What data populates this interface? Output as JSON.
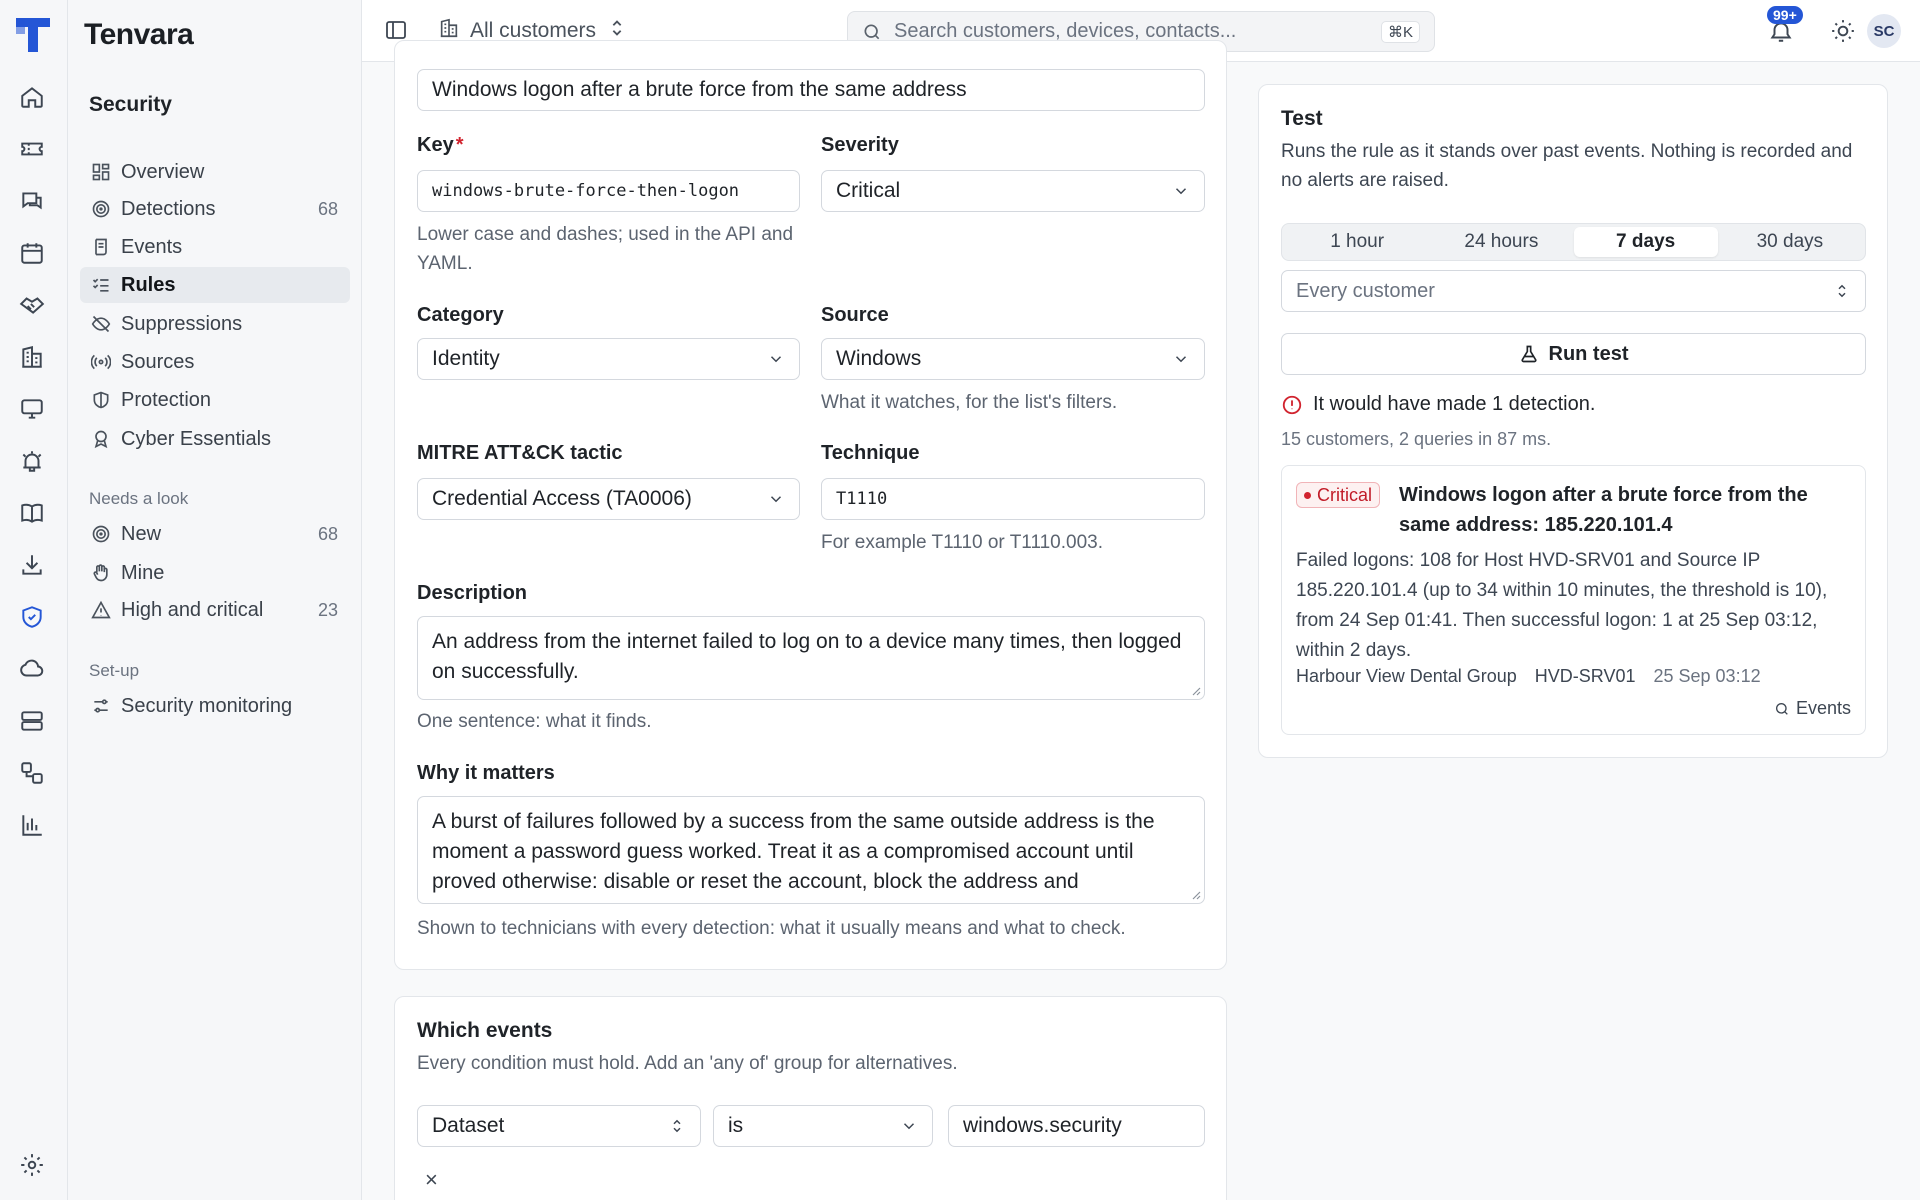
{
  "app": {
    "brand": "Tenvara"
  },
  "rail": {
    "icons": [
      "home-icon",
      "ticket-icon",
      "chat-icon",
      "calendar-icon",
      "handshake-icon",
      "building-icon",
      "monitor-icon",
      "alarm-icon",
      "book-icon",
      "download-icon",
      "shield-icon",
      "cloud-icon",
      "server-icon",
      "workflow-icon",
      "chart-icon",
      "settings-icon"
    ],
    "active": "shield-icon"
  },
  "sidebar": {
    "section_title": "Security",
    "items": [
      {
        "label": "Overview",
        "icon": "dashboard-icon",
        "count": ""
      },
      {
        "label": "Detections",
        "icon": "radar-icon",
        "count": "68"
      },
      {
        "label": "Events",
        "icon": "scroll-icon",
        "count": ""
      },
      {
        "label": "Rules",
        "icon": "list-checks-icon",
        "count": "",
        "active": true
      },
      {
        "label": "Suppressions",
        "icon": "eye-off-icon",
        "count": ""
      },
      {
        "label": "Sources",
        "icon": "broadcast-icon",
        "count": ""
      },
      {
        "label": "Protection",
        "icon": "shield-half-icon",
        "count": ""
      },
      {
        "label": "Cyber Essentials",
        "icon": "award-icon",
        "count": ""
      }
    ],
    "group_look": "Needs a look",
    "look_items": [
      {
        "label": "New",
        "icon": "radar-icon",
        "count": "68"
      },
      {
        "label": "Mine",
        "icon": "hand-icon",
        "count": ""
      },
      {
        "label": "High and critical",
        "icon": "warning-icon",
        "count": "23"
      }
    ],
    "group_setup": "Set-up",
    "setup_items": [
      {
        "label": "Security monitoring",
        "icon": "sliders-icon",
        "count": ""
      }
    ]
  },
  "topbar": {
    "customers_label": "All customers",
    "search_placeholder": "Search customers, devices, contacts...",
    "search_shortcut": "⌘K",
    "notification_badge": "99+",
    "avatar_initials": "SC"
  },
  "form": {
    "name_value": "Windows logon after a brute force from the same address",
    "key_label": "Key",
    "key_required": "*",
    "key_value": "windows-brute-force-then-logon",
    "key_help": "Lower case and dashes; used in the API and YAML.",
    "severity_label": "Severity",
    "severity_value": "Critical",
    "category_label": "Category",
    "category_value": "Identity",
    "source_label": "Source",
    "source_value": "Windows",
    "source_help": "What it watches, for the list's filters.",
    "tactic_label": "MITRE ATT&CK tactic",
    "tactic_value": "Credential Access (TA0006)",
    "technique_label": "Technique",
    "technique_value": "T1110",
    "technique_help": "For example T1110 or T1110.003.",
    "description_label": "Description",
    "description_value": "An address from the internet failed to log on to a device many times, then logged on successfully.",
    "description_help": "One sentence: what it finds.",
    "why_label": "Why it matters",
    "why_value": "A burst of failures followed by a success from the same outside address is the moment a password guess worked. Treat it as a compromised account until proved otherwise: disable or reset the account, block the address and",
    "why_help": "Shown to technicians with every detection: what it usually means and what to check."
  },
  "events": {
    "title": "Which events",
    "subtitle": "Every condition must hold. Add an 'any of' group for alternatives.",
    "field_value": "Dataset",
    "operator_value": "is",
    "match_value": "windows.security",
    "remove_glyph": "×"
  },
  "test": {
    "title": "Test",
    "subtitle": "Runs the rule as it stands over past events. Nothing is recorded and no alerts are raised.",
    "ranges": [
      "1 hour",
      "24 hours",
      "7 days",
      "30 days"
    ],
    "active_range": "7 days",
    "customer_placeholder": "Every customer",
    "run_label": "Run test",
    "result": "It would have made 1 detection.",
    "meta": "15 customers, 2 queries in 87 ms.",
    "detection": {
      "severity": "Critical",
      "title": "Windows logon after a brute force from the same address: 185.220.101.4",
      "body": "Failed logons: 108 for Host HVD-SRV01 and Source IP 185.220.101.4 (up to 34 within 10 minutes, the threshold is 10), from 24 Sep 01:41. Then successful logon: 1 at 25 Sep 03:12, within 2 days.",
      "customer": "Harbour View Dental Group",
      "host": "HVD-SRV01",
      "time": "25 Sep 03:12",
      "link": "Events"
    }
  },
  "colors": {
    "accent": "#2456d6",
    "critical": "#d1242f"
  }
}
